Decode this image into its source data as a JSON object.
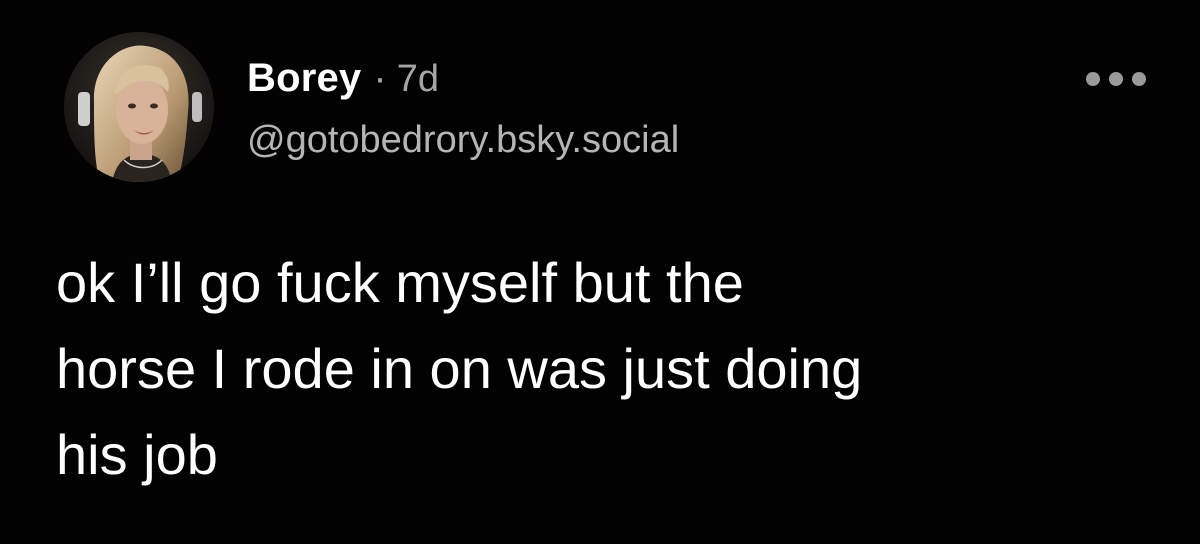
{
  "author": {
    "display_name": "Borey",
    "separator": "·",
    "time_ago": "7d",
    "handle": "@gotobedrory.bsky.social",
    "avatar_icon": "profile-photo-avatar"
  },
  "post": {
    "lines": [
      "ok I’ll go fuck myself but the",
      "horse I rode in on was just doing",
      "his job"
    ]
  },
  "menu": {
    "icon": "more-options-icon"
  },
  "colors": {
    "background": "#020202",
    "text": "#ffffff",
    "muted": "#a6a6a6"
  }
}
